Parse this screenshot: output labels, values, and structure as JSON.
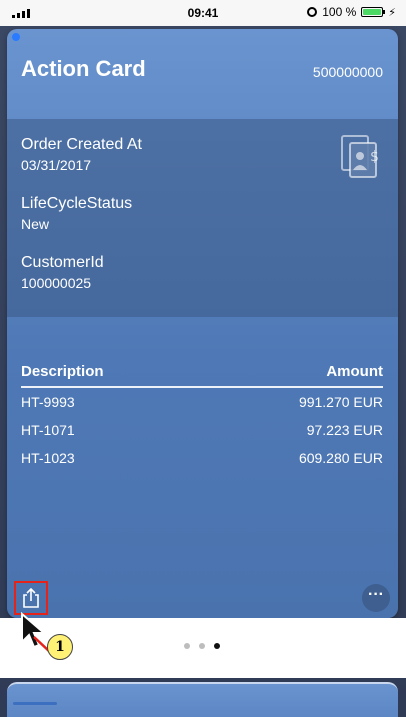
{
  "status_bar": {
    "time": "09:41",
    "battery": "100 %"
  },
  "card": {
    "title": "Action Card",
    "number": "500000000",
    "fields": [
      {
        "label": "Order Created At",
        "value": "03/31/2017"
      },
      {
        "label": "LifeCycleStatus",
        "value": "New"
      },
      {
        "label": "CustomerId",
        "value": "100000025"
      }
    ],
    "table": {
      "headers": [
        "Description",
        "Amount"
      ],
      "rows": [
        [
          "HT-9993",
          "991.270 EUR"
        ],
        [
          "HT-1071",
          "97.223 EUR"
        ],
        [
          "HT-1023",
          "609.280 EUR"
        ]
      ]
    },
    "icons": {
      "document": "invoice-document-icon",
      "share": "share-icon",
      "more": "more-icon"
    }
  },
  "annotation": {
    "step": "1"
  },
  "pager": {
    "count": 3,
    "active": 2
  },
  "colors": {
    "card_top": "#6a94cf",
    "card_bottom": "#4a73ae",
    "highlight": "#e5231b",
    "badge": "#fff176"
  }
}
